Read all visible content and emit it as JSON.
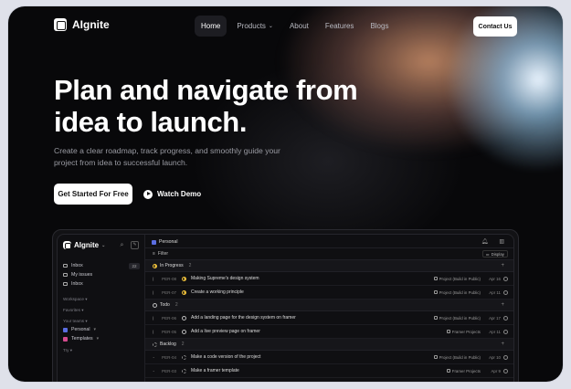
{
  "nav": {
    "brand": "AIgnite",
    "links": [
      {
        "label": "Home",
        "active": true
      },
      {
        "label": "Products",
        "active": false,
        "dropdown": true
      },
      {
        "label": "About",
        "active": false
      },
      {
        "label": "Features",
        "active": false
      },
      {
        "label": "Blogs",
        "active": false
      }
    ],
    "contact_label": "Contact Us"
  },
  "hero": {
    "title_line1": "Plan and navigate from",
    "title_line2": "idea to launch.",
    "subtitle": "Create a clear roadmap, track progress, and smoothly guide your project from idea to successful launch.",
    "primary_cta": "Get Started For Free",
    "secondary_cta": "Watch Demo"
  },
  "app": {
    "sidebar": {
      "brand": "AIgnite",
      "items": [
        {
          "label": "Inbox",
          "count": "22"
        },
        {
          "label": "My issues"
        },
        {
          "label": "Inbox"
        }
      ],
      "workspace_label": "Workspace",
      "favorites_label": "Favorites",
      "teams_label": "Your teams",
      "teams": [
        {
          "label": "Personal",
          "color": "#5b6ee1"
        },
        {
          "label": "Templates",
          "color": "#d54b8f"
        }
      ],
      "try_label": "Try"
    },
    "header": {
      "crumb": "Personal",
      "filter_label": "Filter",
      "display_label": "Display"
    },
    "groups": {
      "in_progress": {
        "label": "In Progress",
        "count": "2"
      },
      "todo": {
        "label": "Todo",
        "count": "2"
      },
      "backlog": {
        "label": "Backlog",
        "count": "2"
      }
    },
    "rows": [
      {
        "id": "PER-08",
        "title": "Making Supreme's design system",
        "project": "Project (Build in Public)",
        "date": "Apr 16",
        "status": "prog"
      },
      {
        "id": "PER-07",
        "title": "Create a working principle",
        "project": "Project (Build in Public)",
        "date": "Apr 11",
        "status": "prog"
      },
      {
        "id": "PER-06",
        "title": "Add a landing page for the design system on framer",
        "project": "Project (Build in Public)",
        "date": "Apr 17",
        "status": "todo"
      },
      {
        "id": "PER-05",
        "title": "Add a live preview page on framer",
        "project": "Framer Projects",
        "date": "Apr 11",
        "status": "todo"
      },
      {
        "id": "PER-04",
        "title": "Make a code version of the project",
        "project": "Project (Build in Public)",
        "date": "Apr 10",
        "status": "back"
      },
      {
        "id": "PER-03",
        "title": "Make a framer template",
        "project": "Framer Projects",
        "date": "Apr 9",
        "status": "back"
      }
    ]
  }
}
